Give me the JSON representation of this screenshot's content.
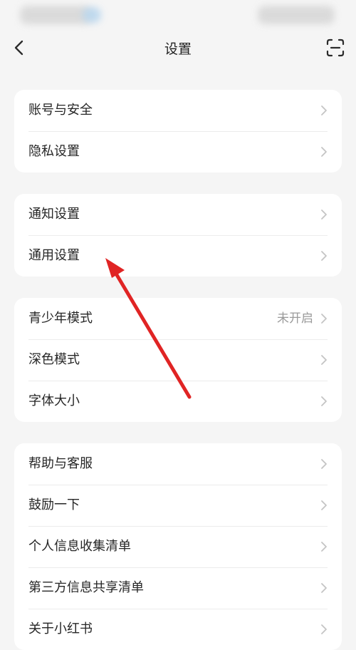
{
  "nav": {
    "title": "设置",
    "back_icon": "chevron-left-icon",
    "scan_icon": "scan-icon"
  },
  "groups": [
    {
      "items": [
        {
          "label": "账号与安全"
        },
        {
          "label": "隐私设置"
        }
      ]
    },
    {
      "items": [
        {
          "label": "通知设置"
        },
        {
          "label": "通用设置"
        }
      ]
    },
    {
      "items": [
        {
          "label": "青少年模式",
          "value": "未开启"
        },
        {
          "label": "深色模式"
        },
        {
          "label": "字体大小"
        }
      ]
    },
    {
      "items": [
        {
          "label": "帮助与客服"
        },
        {
          "label": "鼓励一下"
        },
        {
          "label": "个人信息收集清单"
        },
        {
          "label": "第三方信息共享清单"
        },
        {
          "label": "关于小红书"
        }
      ]
    }
  ],
  "annotation": {
    "type": "arrow",
    "color": "#e02424",
    "points_to": "通用设置"
  },
  "colors": {
    "background": "#f5f5f5",
    "card": "#ffffff",
    "text": "#262626",
    "secondary_text": "#9a9a9a",
    "divider": "#ececec"
  }
}
